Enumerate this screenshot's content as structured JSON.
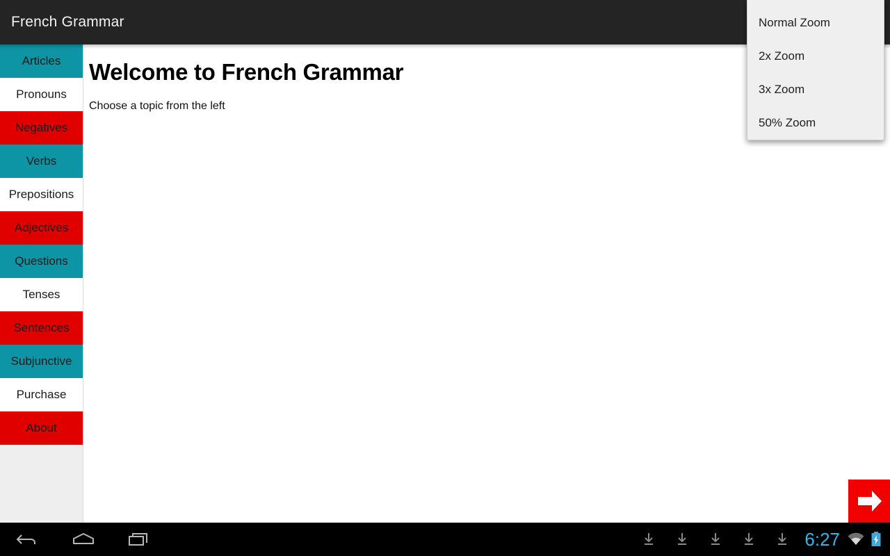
{
  "appbar": {
    "title": "French Grammar"
  },
  "sidebar": {
    "items": [
      {
        "label": "Articles",
        "color": "teal"
      },
      {
        "label": "Pronouns",
        "color": "white"
      },
      {
        "label": "Negatives",
        "color": "red"
      },
      {
        "label": "Verbs",
        "color": "teal"
      },
      {
        "label": "Prepositions",
        "color": "white"
      },
      {
        "label": "Adjectives",
        "color": "red"
      },
      {
        "label": "Questions",
        "color": "teal"
      },
      {
        "label": "Tenses",
        "color": "white"
      },
      {
        "label": "Sentences",
        "color": "red"
      },
      {
        "label": "Subjunctive",
        "color": "teal"
      },
      {
        "label": "Purchase",
        "color": "white"
      },
      {
        "label": "About",
        "color": "red"
      }
    ]
  },
  "main": {
    "title": "Welcome to French Grammar",
    "subtitle": "Choose a topic from the left"
  },
  "menu": {
    "items": [
      {
        "label": "Normal Zoom"
      },
      {
        "label": "2x Zoom"
      },
      {
        "label": "3x Zoom"
      },
      {
        "label": "50% Zoom"
      }
    ]
  },
  "next_button": {
    "icon": "arrow-right-icon",
    "color": "#f20000"
  },
  "navbar": {
    "back": "back-icon",
    "home": "home-icon",
    "recents": "recents-icon",
    "downloads": [
      "download-icon",
      "download-icon",
      "download-icon",
      "download-icon",
      "download-icon"
    ],
    "clock": "6:27",
    "wifi": "wifi-icon",
    "battery": "battery-charging-icon"
  },
  "colors": {
    "teal": "#0d95a5",
    "red": "#e00000",
    "appbar": "#242424",
    "clock_blue": "#33b5e5"
  }
}
